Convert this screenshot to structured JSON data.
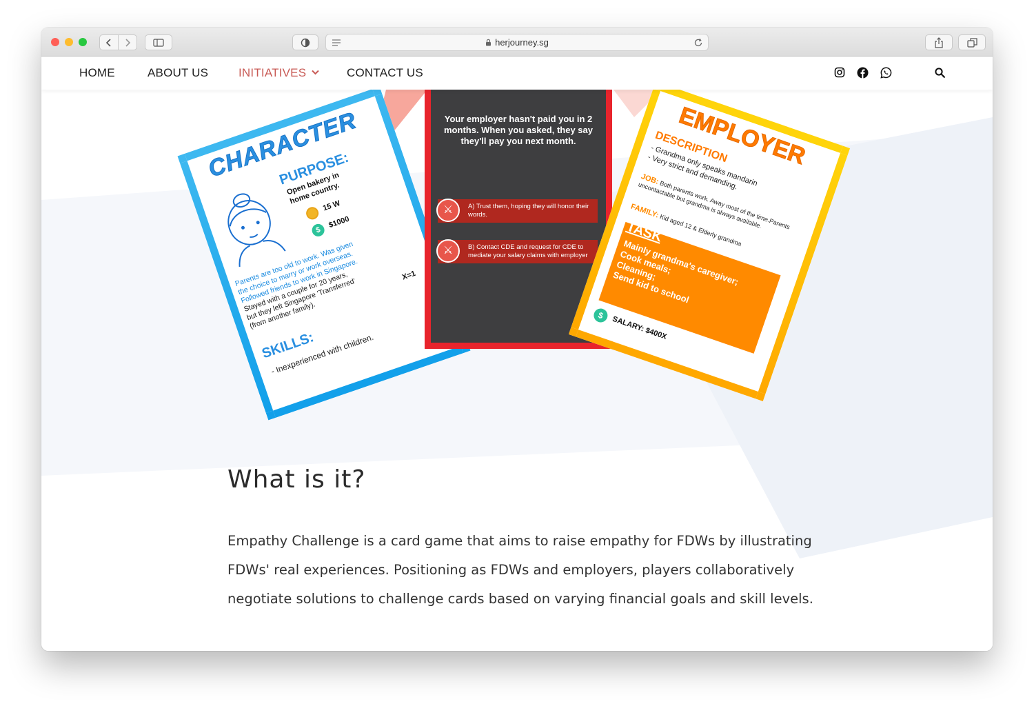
{
  "browser": {
    "url": "herjourney.sg",
    "colors": {
      "close": "#ff5f57",
      "minimize": "#febc2e",
      "zoom": "#28c840"
    }
  },
  "nav": {
    "items": [
      {
        "label": "HOME"
      },
      {
        "label": "ABOUT US"
      },
      {
        "label": "INITIATIVES",
        "active": true
      },
      {
        "label": "CONTACT US"
      }
    ],
    "accent_color": "#c85a55",
    "icons": [
      "instagram-icon",
      "facebook-icon",
      "whatsapp-icon",
      "search-icon"
    ]
  },
  "cards": {
    "character": {
      "title": "CHARACTER",
      "purpose_title": "PURPOSE:",
      "purpose_text_1": "Open bakery in",
      "purpose_text_2": "home country.",
      "energy": "15 W",
      "money": "$1000",
      "story_lines": [
        "Parents are too old to work. Was given",
        "the choice to marry or work overseas.",
        "Followed friends to work in Singapore.",
        "Stayed with a couple for 20 years,",
        "but they left Singapore 'Transferred'",
        "(from another family)."
      ],
      "multiplier": "X=1",
      "skills_title": "SKILLS:",
      "skills_text": "- Inexperienced with children.",
      "color": "#1aa3e8"
    },
    "challenge": {
      "text": "Your employer hasn't paid you in 2 months. When you asked, they say they'll pay you next month.",
      "option_a": "A) Trust them, hoping they will honor their words.",
      "option_b": "B) Contact CDE and request for CDE to mediate your salary claims with employer",
      "color": "#e8242c"
    },
    "employer": {
      "title": "EMPLOYER",
      "desc_title": "DESCRIPTION",
      "desc_1": "- Grandma only speaks mandarin",
      "desc_2": "- Very strict and demanding.",
      "job_label": "JOB:",
      "job_text": "Both parents work. Away most of the time.Parents uncontactable but grandma is always available.",
      "family_label": "FAMILY:",
      "family_text": "Kid aged 12 & Elderly grandma",
      "task_title": "TASK",
      "task_lines": [
        "Mainly grandma's caregiver;",
        "Cook meals;",
        "Cleaning;",
        "Send kid to school"
      ],
      "salary": "SALARY: $400X",
      "color": "#ffb800"
    }
  },
  "section": {
    "heading": "What is it?",
    "body": "Empathy Challenge is a card game that aims to raise empathy for FDWs by illustrating FDWs' real experiences. Positioning as FDWs and employers, players collaboratively negotiate solutions to challenge cards based on varying financial goals and skill levels."
  }
}
